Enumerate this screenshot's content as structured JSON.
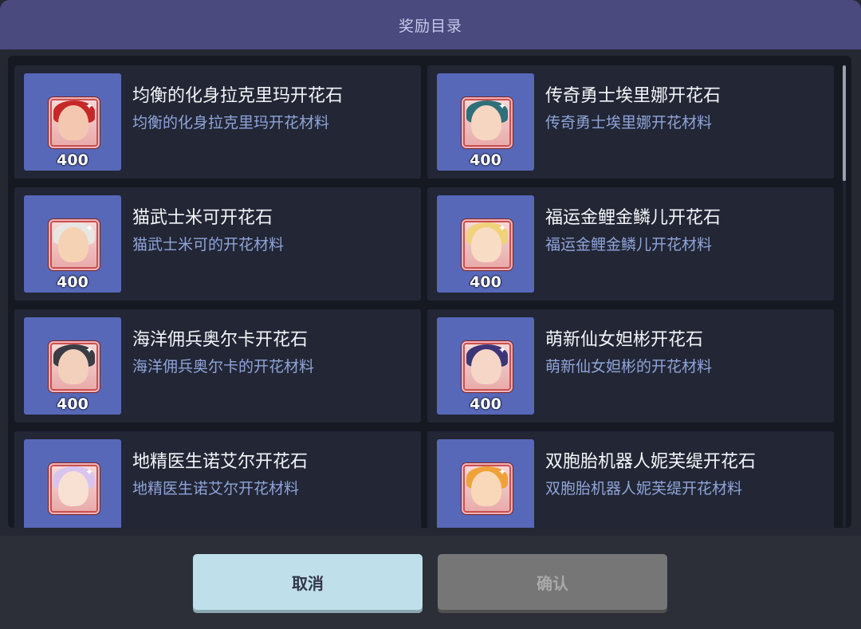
{
  "dialog": {
    "title": "奖励目录",
    "cancel_label": "取消",
    "confirm_label": "确认"
  },
  "items": [
    {
      "name": "均衡的化身拉克里玛开花石",
      "desc": "均衡的化身拉克里玛开花材料",
      "qty": "400",
      "icon": "portrait-red-hair-icon",
      "hair": "#c62828",
      "face": "#f4c8b0"
    },
    {
      "name": "传奇勇士埃里娜开花石",
      "desc": "传奇勇士埃里娜开花材料",
      "qty": "400",
      "icon": "portrait-teal-hair-icon",
      "hair": "#2f6f7a",
      "face": "#f6d6c0"
    },
    {
      "name": "猫武士米可开花石",
      "desc": "猫武士米可的开花材料",
      "qty": "400",
      "icon": "portrait-white-hair-icon",
      "hair": "#e8e6e2",
      "face": "#f6d2b4"
    },
    {
      "name": "福运金鲤金鳞儿开花石",
      "desc": "福运金鲤金鳞儿开花材料",
      "qty": "400",
      "icon": "portrait-blonde-hair-icon",
      "hair": "#f1d27a",
      "face": "#f8dcc4"
    },
    {
      "name": "海洋佣兵奥尔卡开花石",
      "desc": "海洋佣兵奥尔卡的开花材料",
      "qty": "400",
      "icon": "portrait-dark-hair-icon",
      "hair": "#3b3b44",
      "face": "#f2d0bc"
    },
    {
      "name": "萌新仙女妲彬开花石",
      "desc": "萌新仙女妲彬的开花材料",
      "qty": "400",
      "icon": "portrait-purple-hair-icon",
      "hair": "#3d3577",
      "face": "#f6d6c6"
    },
    {
      "name": "地精医生诺艾尔开花石",
      "desc": "地精医生诺艾尔开花材料",
      "qty": "",
      "icon": "portrait-lilac-hair-icon",
      "hair": "#d8c4ee",
      "face": "#f8e0d2"
    },
    {
      "name": "双胞胎机器人妮芙缇开花石",
      "desc": "双胞胎机器人妮芙缇开花材料",
      "qty": "",
      "icon": "portrait-orange-hair-icon",
      "hair": "#f0a23a",
      "face": "#f8d8b8"
    }
  ]
}
